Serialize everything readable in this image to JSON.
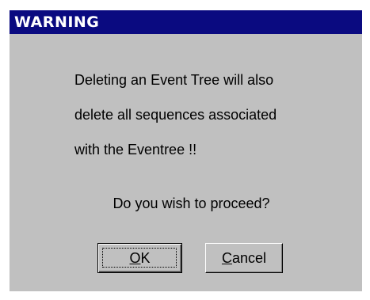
{
  "dialog": {
    "title": "WARNING",
    "message_lines": [
      "Deleting an Event Tree will also",
      "delete all sequences associated",
      "with the Eventree !!"
    ],
    "question": "Do you wish to proceed?",
    "buttons": {
      "ok": {
        "mnemonic": "O",
        "rest": "K"
      },
      "cancel": {
        "mnemonic": "C",
        "rest": "ancel"
      }
    }
  },
  "colors": {
    "titlebar": "#0a0a80",
    "face": "#c0c0c0",
    "title_text": "#ffffff"
  }
}
